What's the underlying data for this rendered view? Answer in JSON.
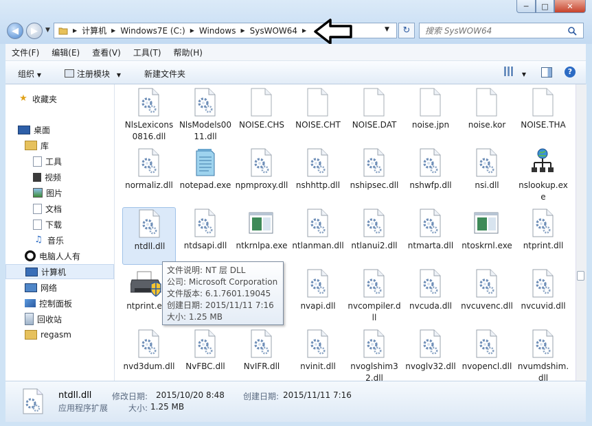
{
  "window": {
    "minimize": "0",
    "maximize": "1",
    "close": "r"
  },
  "address": {
    "crumbs": [
      "计算机",
      "Windows7E (C:)",
      "Windows",
      "SysWOW64"
    ]
  },
  "search": {
    "placeholder": "搜索 SysWOW64"
  },
  "menu": [
    "文件(F)",
    "编辑(E)",
    "查看(V)",
    "工具(T)",
    "帮助(H)"
  ],
  "toolbar": {
    "organize": "组织",
    "register": "注册模块",
    "new_folder": "新建文件夹"
  },
  "nav": {
    "favorites": "收藏夹",
    "desktop": "桌面",
    "library": "库",
    "library_items": [
      "工具",
      "视频",
      "图片",
      "文档",
      "下载",
      "音乐"
    ],
    "renren": "电脑人人有",
    "computer": "计算机",
    "network": "网络",
    "control_panel": "控制面板",
    "recycle": "回收站",
    "regasm": "regasm"
  },
  "files": [
    {
      "name": "NlsLexicons0816.dll",
      "icon": "dll"
    },
    {
      "name": "NlsModels0011.dll",
      "icon": "dll"
    },
    {
      "name": "NOISE.CHS",
      "icon": "blank"
    },
    {
      "name": "NOISE.CHT",
      "icon": "blank"
    },
    {
      "name": "NOISE.DAT",
      "icon": "blank"
    },
    {
      "name": "noise.jpn",
      "icon": "blank"
    },
    {
      "name": "noise.kor",
      "icon": "blank"
    },
    {
      "name": "NOISE.THA",
      "icon": "blank"
    },
    {
      "name": "normaliz.dll",
      "icon": "dll"
    },
    {
      "name": "notepad.exe",
      "icon": "notepad"
    },
    {
      "name": "npmproxy.dll",
      "icon": "dll"
    },
    {
      "name": "nshhttp.dll",
      "icon": "dll"
    },
    {
      "name": "nshipsec.dll",
      "icon": "dll"
    },
    {
      "name": "nshwfp.dll",
      "icon": "dll"
    },
    {
      "name": "nsi.dll",
      "icon": "dll"
    },
    {
      "name": "nslookup.exe",
      "icon": "network"
    },
    {
      "name": "ntdll.dll",
      "icon": "dll"
    },
    {
      "name": "ntdsapi.dll",
      "icon": "dll"
    },
    {
      "name": "ntkrnlpa.exe",
      "icon": "window"
    },
    {
      "name": "ntlanman.dll",
      "icon": "dll"
    },
    {
      "name": "ntlanui2.dll",
      "icon": "dll"
    },
    {
      "name": "ntmarta.dll",
      "icon": "dll"
    },
    {
      "name": "ntoskrnl.exe",
      "icon": "window"
    },
    {
      "name": "ntprint.dll",
      "icon": "dll"
    },
    {
      "name": "ntprint.exe",
      "icon": "printer"
    },
    {
      "name": "",
      "icon": "none"
    },
    {
      "name": "",
      "icon": "none"
    },
    {
      "name": "nvapi.dll",
      "icon": "dll"
    },
    {
      "name": "nvcompiler.dll",
      "icon": "dll"
    },
    {
      "name": "nvcuda.dll",
      "icon": "dll"
    },
    {
      "name": "nvcuvenc.dll",
      "icon": "dll"
    },
    {
      "name": "nvcuvid.dll",
      "icon": "dll"
    },
    {
      "name": "nvd3dum.dll",
      "icon": "dll"
    },
    {
      "name": "NvFBC.dll",
      "icon": "dll"
    },
    {
      "name": "NvIFR.dll",
      "icon": "dll"
    },
    {
      "name": "nvinit.dll",
      "icon": "dll"
    },
    {
      "name": "nvoglshim32.dll",
      "icon": "dll"
    },
    {
      "name": "nvoglv32.dll",
      "icon": "dll"
    },
    {
      "name": "nvopencl.dll",
      "icon": "dll"
    },
    {
      "name": "nvumdshim.dll",
      "icon": "dll"
    }
  ],
  "tooltip": {
    "desc": "文件说明: NT 层 DLL",
    "company": "公司: Microsoft Corporation",
    "version": "文件版本: 6.1.7601.19045",
    "created": "创建日期: 2015/11/11 7:16",
    "size": "大小: 1.25 MB"
  },
  "details": {
    "name": "ntdll.dll",
    "type": "应用程序扩展",
    "modified_label": "修改日期:",
    "modified": "2015/10/20 8:48",
    "size_label": "大小:",
    "size": "1.25 MB",
    "created_label": "创建日期:",
    "created": "2015/11/11 7:16"
  },
  "colors": {
    "selection": "#dbe9f9",
    "accent": "#2c5aa0"
  }
}
